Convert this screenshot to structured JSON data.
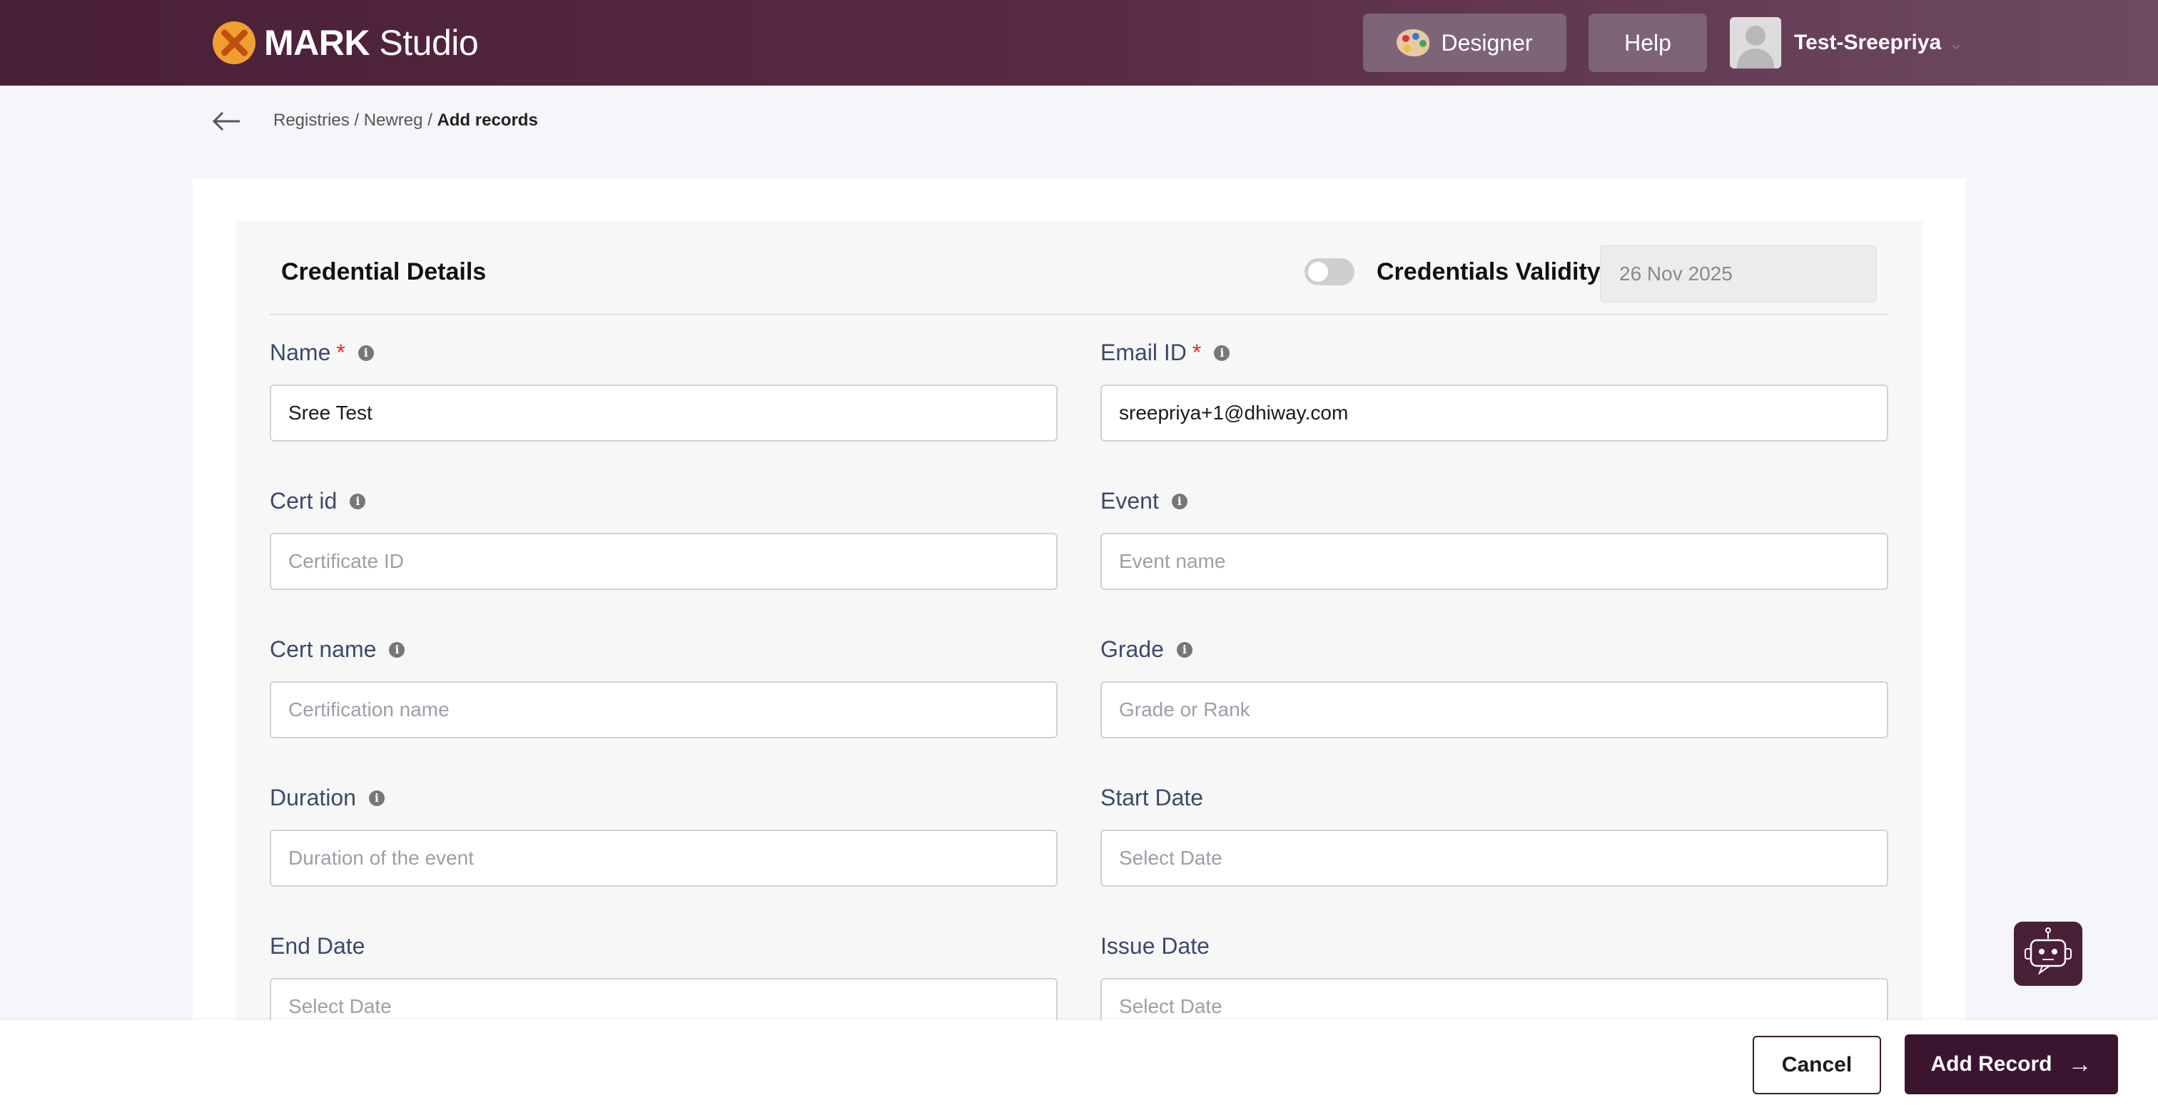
{
  "header": {
    "logo_bold": "MARK",
    "logo_light": "Studio",
    "designer_label": "Designer",
    "help_label": "Help",
    "user_name": "Test-Sreepriya"
  },
  "breadcrumb": {
    "items": [
      "Registries",
      "Newreg"
    ],
    "current": "Add records"
  },
  "form": {
    "title": "Credential Details",
    "validity_label": "Credentials Validity",
    "validity_date": "26 Nov 2025",
    "validity_enabled": false,
    "fields": [
      {
        "label": "Name",
        "required": true,
        "info": true,
        "value": "Sree Test",
        "placeholder": ""
      },
      {
        "label": "Email ID",
        "required": true,
        "info": true,
        "value": "sreepriya+1@dhiway.com",
        "placeholder": ""
      },
      {
        "label": "Cert id",
        "required": false,
        "info": true,
        "value": "",
        "placeholder": "Certificate ID"
      },
      {
        "label": "Event",
        "required": false,
        "info": true,
        "value": "",
        "placeholder": "Event name"
      },
      {
        "label": "Cert name",
        "required": false,
        "info": true,
        "value": "",
        "placeholder": "Certification name"
      },
      {
        "label": "Grade",
        "required": false,
        "info": true,
        "value": "",
        "placeholder": "Grade or Rank"
      },
      {
        "label": "Duration",
        "required": false,
        "info": true,
        "value": "",
        "placeholder": "Duration of the event"
      },
      {
        "label": "Start Date",
        "required": false,
        "info": false,
        "value": "",
        "placeholder": "Select Date"
      },
      {
        "label": "End Date",
        "required": false,
        "info": false,
        "value": "",
        "placeholder": "Select Date"
      },
      {
        "label": "Issue Date",
        "required": false,
        "info": false,
        "value": "",
        "placeholder": "Select Date"
      }
    ]
  },
  "footer": {
    "cancel_label": "Cancel",
    "add_label": "Add Record"
  },
  "colors": {
    "brand": "#4a1f38",
    "primary_button": "#3b1530",
    "required": "#d0342c",
    "label": "#3b4a6b"
  }
}
